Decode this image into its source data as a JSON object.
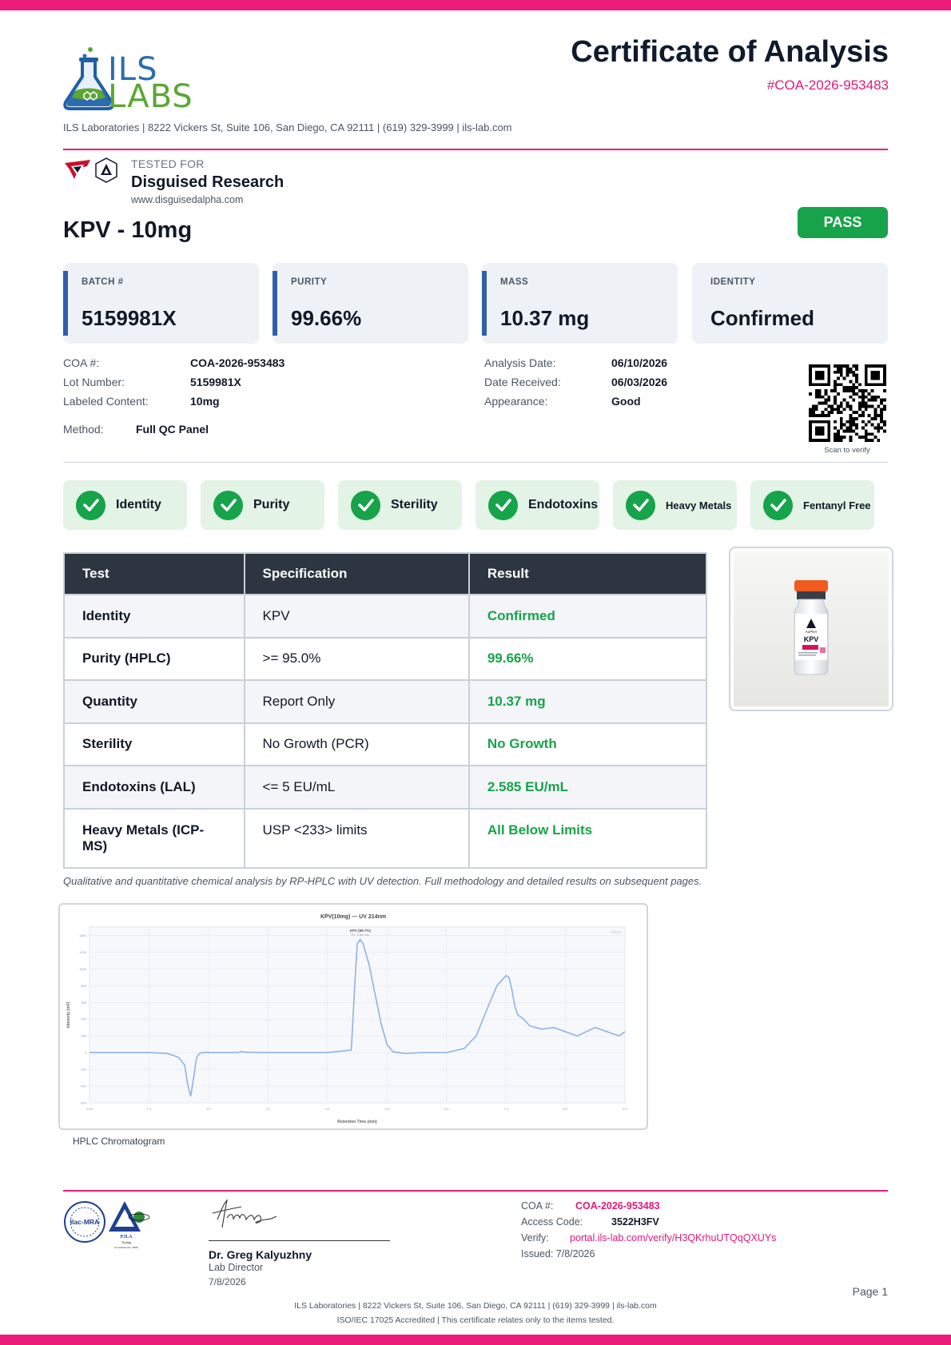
{
  "lab": {
    "logo_top": "ILS",
    "logo_bottom": "LABS",
    "address_line": "ILS Laboratories  |  8222 Vickers St, Suite 106, San Diego, CA 92111  |  (619) 329-3999  |  ils-lab.com"
  },
  "header": {
    "title": "Certificate of Analysis",
    "coa_id": "#COA-2026-953483"
  },
  "client": {
    "label": "TESTED FOR",
    "name": "Disguised Research",
    "url": "www.disguisedalpha.com"
  },
  "product": {
    "name": "KPV - 10mg",
    "status": "PASS"
  },
  "summary_cards": [
    {
      "label": "BATCH #",
      "value": "5159981X"
    },
    {
      "label": "PURITY",
      "value": "99.66%"
    },
    {
      "label": "MASS",
      "value": "10.37 mg"
    },
    {
      "label": "IDENTITY",
      "value": "Confirmed"
    }
  ],
  "details_left": [
    {
      "label": "COA #:",
      "value": "COA-2026-953483"
    },
    {
      "label": "Lot Number:",
      "value": "5159981X"
    },
    {
      "label": "Labeled Content:",
      "value": "10mg"
    }
  ],
  "method": {
    "label": "Method:",
    "value": "Full QC Panel"
  },
  "details_right": [
    {
      "label": "Analysis Date:",
      "value": "06/10/2026"
    },
    {
      "label": "Date Received:",
      "value": "06/03/2026"
    },
    {
      "label": "Appearance:",
      "value": "Good"
    }
  ],
  "qr": {
    "caption": "Scan to verify"
  },
  "checks": [
    "Identity",
    "Purity",
    "Sterility",
    "Endotoxins",
    "Heavy Metals",
    "Fentanyl Free"
  ],
  "results_table": {
    "headers": [
      "Test",
      "Specification",
      "Result"
    ],
    "rows": [
      {
        "test": "Identity",
        "spec": "KPV",
        "result": "Confirmed"
      },
      {
        "test": "Purity (HPLC)",
        "spec": ">= 95.0%",
        "result": "99.66%"
      },
      {
        "test": "Quantity",
        "spec": "Report Only",
        "result": "10.37 mg"
      },
      {
        "test": "Sterility",
        "spec": "No Growth (PCR)",
        "result": "No Growth"
      },
      {
        "test": "Endotoxins (LAL)",
        "spec": "<= 5 EU/mL",
        "result": "2.585 EU/mL"
      },
      {
        "test": "Heavy Metals (ICP-MS)",
        "spec": "USP <233> limits",
        "result": "All Below Limits"
      }
    ]
  },
  "vial": {
    "label": "KPV",
    "brand": "ALPHA"
  },
  "method_note": "Qualitative and quantitative chemical analysis by RP-HPLC with UV detection. Full methodology and detailed results on subsequent pages.",
  "chart_data": {
    "type": "line",
    "title": "KPV(10mg) — UV 214nm",
    "peak_label": "KPV (99.7%)",
    "peak_sublabel": "RT: 4.56 min",
    "corner_label": "Clean",
    "xlabel": "Retention Time (min)",
    "ylabel": "Intensity (mV)",
    "xlim": [
      0,
      9
    ],
    "ylim": [
      -600,
      1500
    ],
    "x_ticks": [
      "0.00",
      "1.0",
      "2.0",
      "3.0",
      "4.0",
      "5.0",
      "6.0",
      "7.0",
      "8.0",
      "9.0"
    ],
    "y_ticks": [
      "-600",
      "-400",
      "-200",
      "0",
      "200",
      "400",
      "600",
      "800",
      "1000",
      "1200",
      "1400"
    ],
    "x": [
      0,
      0.5,
      1.0,
      1.3,
      1.4,
      1.5,
      1.6,
      1.65,
      1.7,
      1.75,
      1.8,
      1.85,
      1.9,
      2.5,
      2.55,
      2.6,
      3.0,
      4.0,
      4.4,
      4.45,
      4.5,
      4.55,
      4.6,
      4.7,
      4.8,
      4.9,
      5.0,
      5.1,
      5.3,
      5.6,
      6.0,
      6.3,
      6.5,
      6.7,
      6.85,
      7.0,
      7.05,
      7.1,
      7.15,
      7.2,
      7.3,
      7.4,
      7.5,
      7.6,
      7.8,
      8.0,
      8.2,
      8.5,
      8.7,
      8.9,
      9.0
    ],
    "y": [
      0,
      0,
      0,
      -10,
      -30,
      -60,
      -150,
      -380,
      -520,
      -300,
      -60,
      -10,
      0,
      0,
      15,
      5,
      0,
      0,
      30,
      700,
      1300,
      1350,
      1300,
      1050,
      700,
      350,
      100,
      10,
      -10,
      0,
      0,
      50,
      200,
      550,
      800,
      920,
      900,
      750,
      550,
      450,
      400,
      320,
      300,
      280,
      300,
      250,
      200,
      300,
      250,
      200,
      250
    ]
  },
  "chart_caption": "HPLC Chromatogram",
  "signature": {
    "name": "Dr. Greg Kalyuzhny",
    "role": "Lab Director",
    "date": "7/8/2026"
  },
  "accreditation": {
    "ilac": "ilac-MRA",
    "pjla_name": "PJLA",
    "pjla_sub": "Testing",
    "pjla_accr": "Accreditation No. 59662"
  },
  "verification": {
    "coa_label": "COA #:",
    "coa_value": "COA-2026-953483",
    "access_label": "Access Code:",
    "access_value": "3522H3FV",
    "verify_label": "Verify:",
    "verify_url": "portal.ils-lab.com/verify/H3QKrhuUTQqQXUYs",
    "issued": "Issued: 7/8/2026"
  },
  "footer": {
    "page": "Page 1",
    "line1": "ILS Laboratories  |  8222 Vickers St, Suite 106, San Diego, CA 92111  |  (619) 329-3999  |  ils-lab.com",
    "line2": "ISO/IEC 17025 Accredited  |  This certificate relates only to the items tested."
  },
  "colors": {
    "accent": "#ec1c7a",
    "pass_green": "#16a34a",
    "card_edge": "#2f5fa8",
    "table_header": "#2d3640",
    "logo_blue": "#2a6cae",
    "logo_green": "#5ca634",
    "chart_line": "#8fb3e3"
  }
}
